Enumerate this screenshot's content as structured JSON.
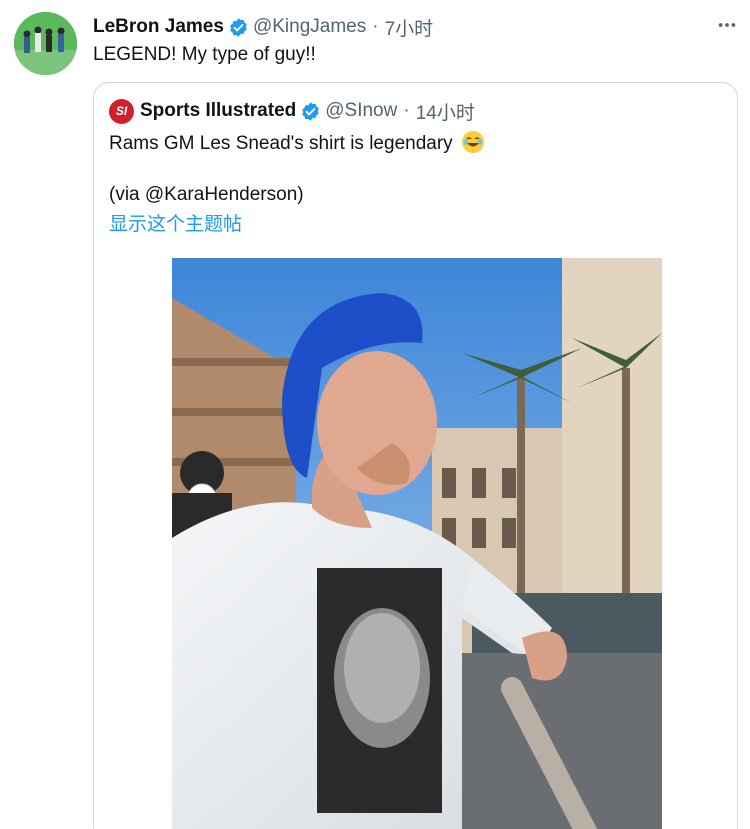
{
  "tweet": {
    "author_name": "LeBron James",
    "author_handle": "@KingJames",
    "separator": "·",
    "time": "7小时",
    "text": "LEGEND! My type of guy!!",
    "avatar_icon": "avatar-group-photo",
    "verified_icon": "verified-badge-icon",
    "more_icon": "more-options-icon"
  },
  "quote": {
    "logo_text": "SI",
    "author_name": "Sports Illustrated",
    "author_handle": "@SInow",
    "separator": "·",
    "time": "14小时",
    "text": "Rams GM Les Snead's shirt is legendary",
    "emoji_icon": "laughing-tears-emoji",
    "via": "(via @KaraHenderson)",
    "show_thread": "显示这个主题帖",
    "photo": "man-in-blue-cap-white-shirt-photo"
  },
  "colors": {
    "text": "#0f1419",
    "secondary": "#536471",
    "link": "#1d9bf0",
    "verified": "#1d9bf0",
    "border": "#cfd9de",
    "si_red": "#d0202a"
  }
}
